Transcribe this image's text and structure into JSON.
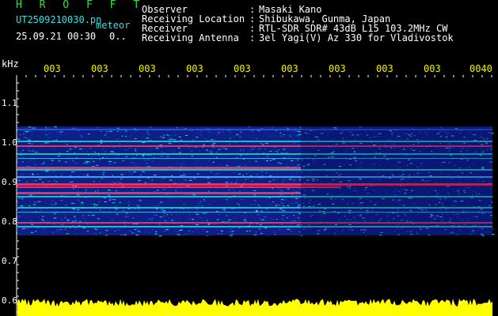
{
  "header": {
    "brand": "H R O F F T",
    "file_name": "UT2509210030.pn",
    "mode": "meteor",
    "timestamp": "25.09.21 00:30",
    "counter": "0.."
  },
  "info": {
    "rows": [
      {
        "label": "Observer",
        "value": "Masaki Kano"
      },
      {
        "label": "Receiving Location",
        "value": "Shibukawa, Gunma, Japan"
      },
      {
        "label": "Receiver",
        "value": "RTL-SDR SDR# 43dB L15 103.2MHz CW"
      },
      {
        "label": "Receiving Antenna",
        "value": "3el Yagi(V) Az 330 for Vladivostok"
      }
    ],
    "separator": ":"
  },
  "y_axis": {
    "unit": "kHz",
    "ticks": [
      "1.1",
      "1.0",
      "0.9",
      "0.8",
      "0.7",
      "0.6"
    ]
  },
  "x_axis": {
    "ticks": [
      "003",
      "003",
      "003",
      "003",
      "003",
      "003",
      "003",
      "003",
      "003",
      "0040"
    ]
  },
  "colors": {
    "brand": "#2ee62e",
    "info": "#37e0e0",
    "axis_labels": "#f2f200",
    "signal_hot": "#ff3a6a",
    "signal_mid": "#21d6c8",
    "signal_base": "#1d3fbf",
    "noise_bar": "#ffff00"
  }
}
